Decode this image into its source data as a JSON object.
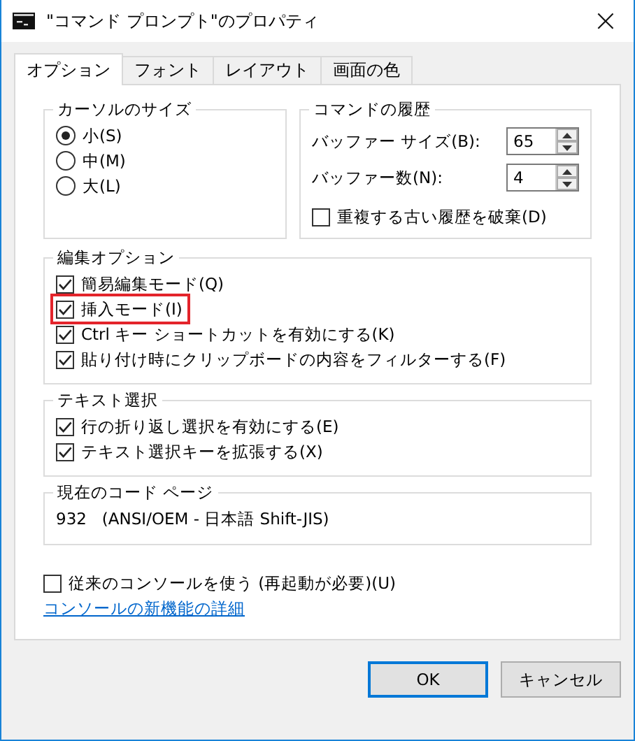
{
  "window": {
    "title": "\"コマンド プロンプト\"のプロパティ",
    "close": "×"
  },
  "tabs": [
    {
      "label": "オプション",
      "selected": true
    },
    {
      "label": "フォント",
      "selected": false
    },
    {
      "label": "レイアウト",
      "selected": false
    },
    {
      "label": "画面の色",
      "selected": false
    }
  ],
  "cursor_size": {
    "title": "カーソルのサイズ",
    "options": [
      {
        "label": "小(S)",
        "selected": true
      },
      {
        "label": "中(M)",
        "selected": false
      },
      {
        "label": "大(L)",
        "selected": false
      }
    ]
  },
  "command_history": {
    "title": "コマンドの履歴",
    "fields": [
      {
        "label": "バッファー サイズ(B):",
        "value": "65"
      },
      {
        "label": "バッファー数(N):",
        "value": "4"
      }
    ],
    "discard_duplicates": {
      "label": "重複する古い履歴を破棄(D)",
      "checked": false
    }
  },
  "edit_options": {
    "title": "編集オプション",
    "items": [
      {
        "label": "簡易編集モード(Q)",
        "checked": true,
        "highlighted": false
      },
      {
        "label": "挿入モード(I)",
        "checked": true,
        "highlighted": true
      },
      {
        "label": "Ctrl キー ショートカットを有効にする(K)",
        "checked": true,
        "highlighted": false
      },
      {
        "label": "貼り付け時にクリップボードの内容をフィルターする(F)",
        "checked": true,
        "highlighted": false
      }
    ]
  },
  "text_selection": {
    "title": "テキスト選択",
    "items": [
      {
        "label": "行の折り返し選択を有効にする(E)",
        "checked": true
      },
      {
        "label": "テキスト選択キーを拡張する(X)",
        "checked": true
      }
    ]
  },
  "code_page": {
    "title": "現在のコード ページ",
    "value": "932   (ANSI/OEM - 日本語 Shift-JIS)"
  },
  "legacy_console": {
    "label": "従来のコンソールを使う (再起動が必要)(U)",
    "checked": false
  },
  "link": "コンソールの新機能の詳細",
  "buttons": [
    {
      "label": "OK",
      "default": true
    },
    {
      "label": "キャンセル",
      "default": false
    }
  ]
}
